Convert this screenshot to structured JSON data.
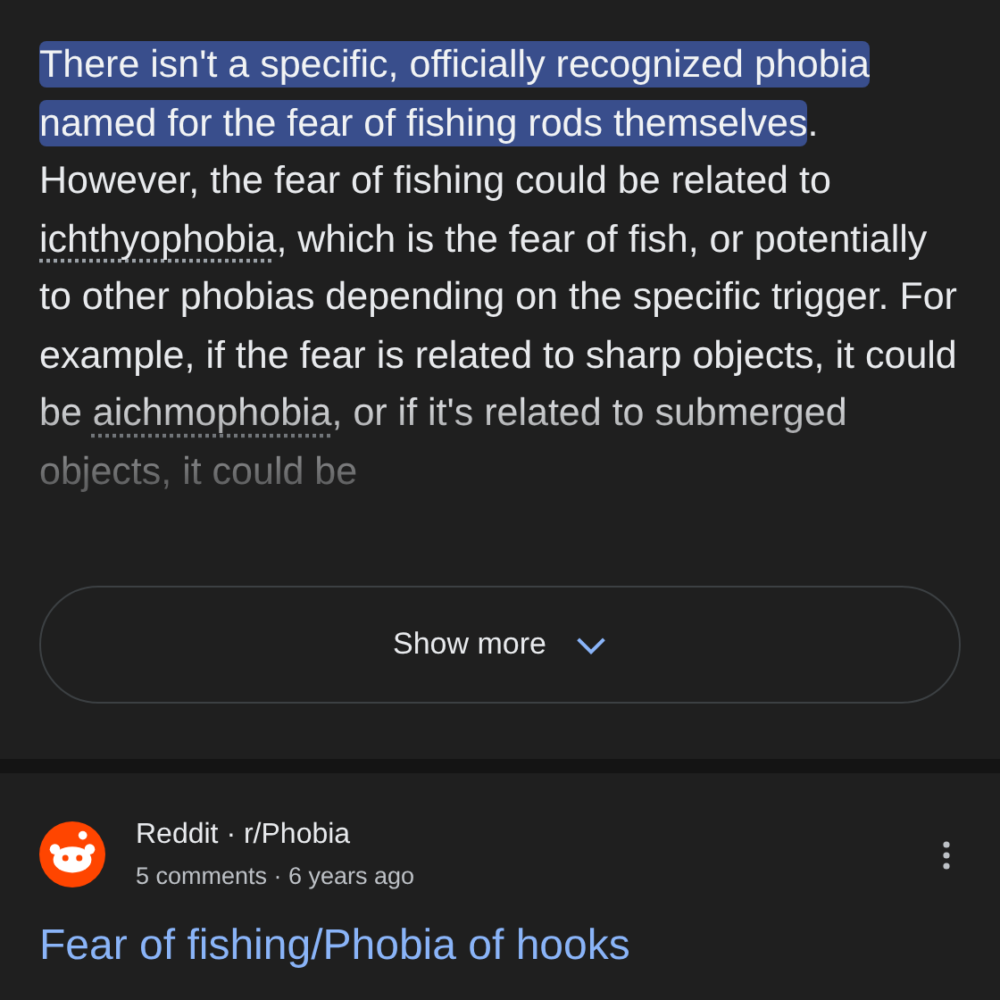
{
  "answer": {
    "segments": [
      {
        "kind": "highlight",
        "text": "There isn't a specific, officially recognized phobia named for the fear of fishing rods themselves"
      },
      {
        "kind": "plain",
        "text": ". However, the fear of fishing could be related to "
      },
      {
        "kind": "term",
        "text": "ichthyophobia"
      },
      {
        "kind": "plain",
        "text": ", which is the fear of fish, or potentially to other phobias depending on the specific trigger. For example, if the fear is related to sharp objects, it could be "
      },
      {
        "kind": "term",
        "text": "aichmophobia"
      },
      {
        "kind": "plain",
        "text": ", or if it's related to submerged objects, it could be"
      }
    ]
  },
  "show_more": {
    "label": "Show more"
  },
  "result": {
    "source": "Reddit · r/Phobia",
    "meta": "5 comments · 6 years ago",
    "title": "Fear of fishing/Phobia of hooks"
  }
}
